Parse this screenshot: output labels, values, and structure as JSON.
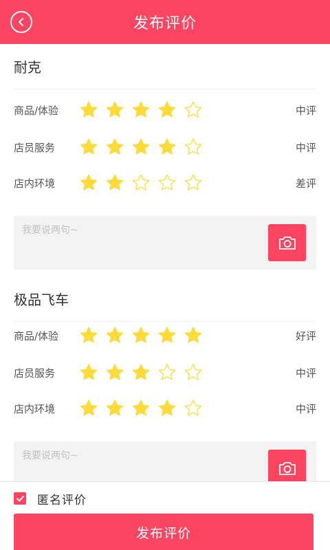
{
  "header": {
    "title": "发布评价",
    "back_icon": "chevron-left-icon"
  },
  "colors": {
    "accent": "#fd4461",
    "star_filled": "#fddb3a",
    "star_outline": "#fddb3a"
  },
  "shops": [
    {
      "name": "耐克",
      "ratings": [
        {
          "label": "商品/体验",
          "stars": 4,
          "verdict": "中评"
        },
        {
          "label": "店员服务",
          "stars": 4,
          "verdict": "中评"
        },
        {
          "label": "店内环境",
          "stars": 2,
          "verdict": "差评"
        }
      ],
      "comment": {
        "value": "",
        "placeholder": "我要说两句~"
      },
      "camera_icon": "camera-icon"
    },
    {
      "name": "极品飞车",
      "ratings": [
        {
          "label": "商品/体验",
          "stars": 5,
          "verdict": "好评"
        },
        {
          "label": "店员服务",
          "stars": 3,
          "verdict": "中评"
        },
        {
          "label": "店内环境",
          "stars": 4,
          "verdict": "中评"
        }
      ],
      "comment": {
        "value": "",
        "placeholder": "我要说两句~"
      },
      "camera_icon": "camera-icon"
    }
  ],
  "footer": {
    "anonymous": {
      "label": "匿名评价",
      "checked": true
    },
    "submit_label": "发布评价"
  }
}
